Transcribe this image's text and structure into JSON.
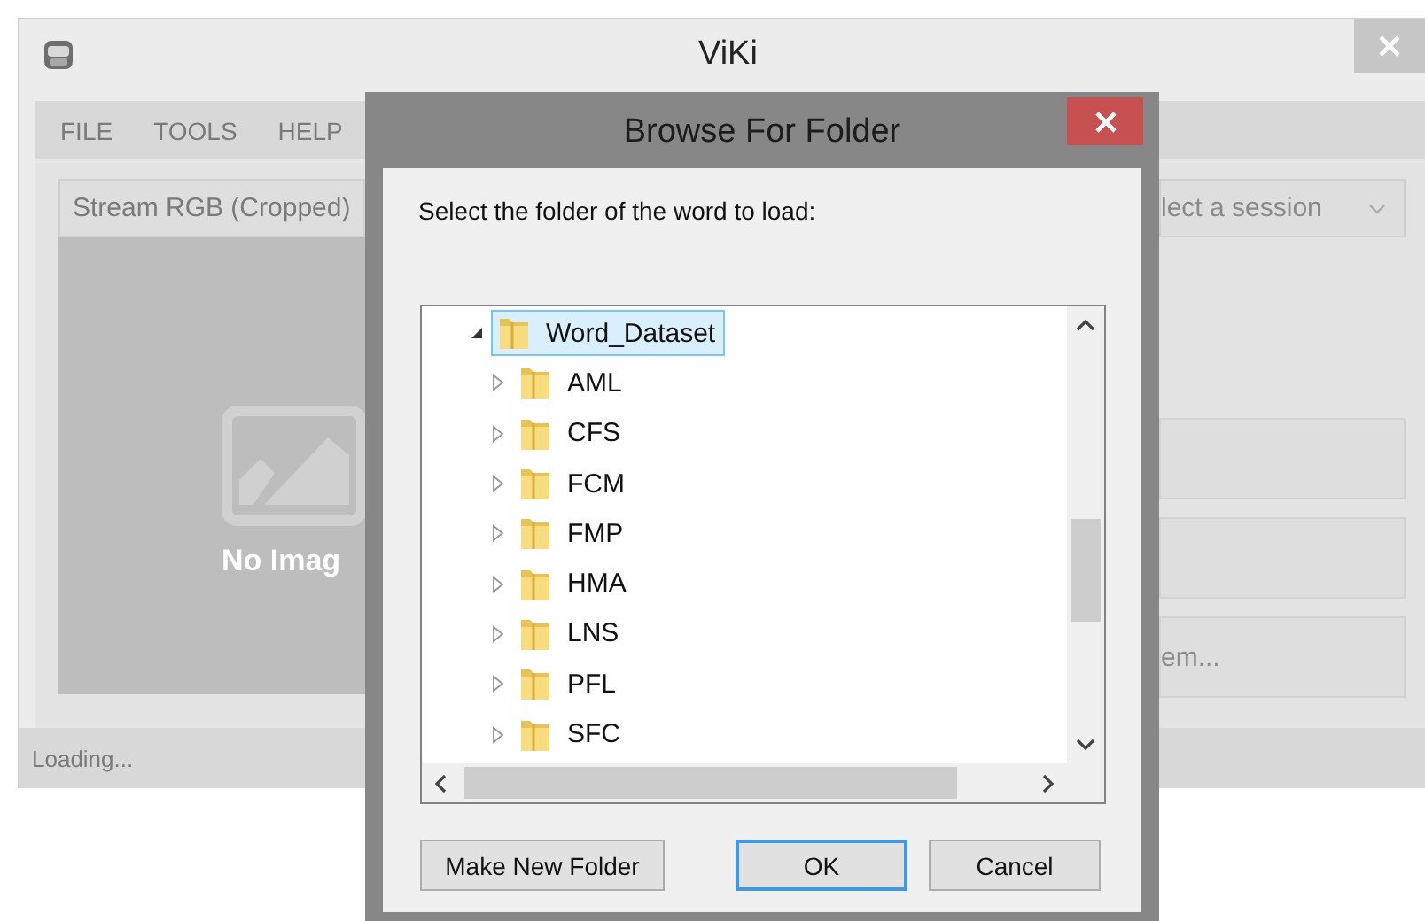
{
  "window": {
    "title": "ViKi"
  },
  "menu": [
    {
      "label": "FILE"
    },
    {
      "label": "TOOLS"
    },
    {
      "label": "HELP"
    }
  ],
  "stream_select": {
    "value": "Stream RGB (Cropped)"
  },
  "image_placeholder": {
    "label": "No Imag"
  },
  "session_select": {
    "value": "lect a session"
  },
  "side_buttons": [
    {
      "kind": "blank"
    },
    {
      "kind": "blank"
    },
    {
      "kind": "text",
      "label": "em..."
    }
  ],
  "status_bar": {
    "text": "Loading..."
  },
  "dialog": {
    "title": "Browse For Folder",
    "prompt": "Select the folder of the word to load:",
    "tree": {
      "label": "Word_Dataset",
      "expanded": true,
      "selected": true,
      "children": [
        {
          "label": "AML",
          "expanded": false,
          "selected": false
        },
        {
          "label": "CFS",
          "expanded": false,
          "selected": false
        },
        {
          "label": "FCM",
          "expanded": false,
          "selected": false
        },
        {
          "label": "FMP",
          "expanded": false,
          "selected": false
        },
        {
          "label": "HMA",
          "expanded": false,
          "selected": false
        },
        {
          "label": "LNS",
          "expanded": false,
          "selected": false
        },
        {
          "label": "PFL",
          "expanded": false,
          "selected": false
        },
        {
          "label": "SFC",
          "expanded": false,
          "selected": false
        }
      ]
    },
    "buttons": [
      {
        "label": "Make New Folder",
        "focused": false
      },
      {
        "label": "OK",
        "focused": true
      },
      {
        "label": "Cancel",
        "focused": false
      }
    ]
  }
}
